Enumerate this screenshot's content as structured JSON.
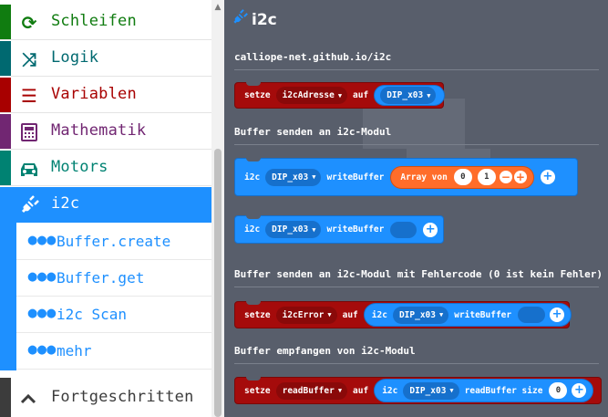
{
  "toolbox": {
    "categories": [
      {
        "label": "Schleifen",
        "icon": "refresh-icon",
        "color": "#107c10"
      },
      {
        "label": "Logik",
        "icon": "shuffle-icon",
        "color": "#006970"
      },
      {
        "label": "Variablen",
        "icon": "list-icon",
        "color": "#a80000"
      },
      {
        "label": "Mathematik",
        "icon": "calculator-icon",
        "color": "#712672"
      },
      {
        "label": "Motors",
        "icon": "car-icon",
        "color": "#008272"
      },
      {
        "label": "i2c",
        "icon": "plug-icon",
        "color": "#1e90ff"
      }
    ],
    "subitems": [
      {
        "label": "Buffer.create"
      },
      {
        "label": "Buffer.get"
      },
      {
        "label": "i2c Scan"
      },
      {
        "label": "mehr"
      }
    ],
    "advanced_label": "Fortgeschritten"
  },
  "flyout": {
    "title": "i2c",
    "labels": {
      "url": "calliope-net.github.io/i2c",
      "send": "Buffer senden an i2c-Modul",
      "send_error": "Buffer senden an i2c-Modul mit Fehlercode (0 ist kein Fehler)",
      "receive": "Buffer empfangen von i2c-Modul"
    },
    "blocks": {
      "set_address": {
        "setze": "setze",
        "var": "i2cAdresse",
        "auf": "auf",
        "value": "DIP_x03"
      },
      "write_array": {
        "i2c": "i2c",
        "addr": "DIP_x03",
        "method": "writeBuffer",
        "array_label": "Array von",
        "v0": "0",
        "v1": "1"
      },
      "write_empty": {
        "i2c": "i2c",
        "addr": "DIP_x03",
        "method": "writeBuffer"
      },
      "set_error": {
        "setze": "setze",
        "var": "i2cError",
        "auf": "auf",
        "i2c": "i2c",
        "addr": "DIP_x03",
        "method": "writeBuffer"
      },
      "set_read": {
        "setze": "setze",
        "var": "readBuffer",
        "auf": "auf",
        "i2c": "i2c",
        "addr": "DIP_x03",
        "method": "readBuffer size",
        "size": "0"
      }
    }
  },
  "colors": {
    "accent": "#1e90ff",
    "variables": "#a50b0b",
    "array": "#ff6d2a",
    "workspace": "#585e6b"
  }
}
